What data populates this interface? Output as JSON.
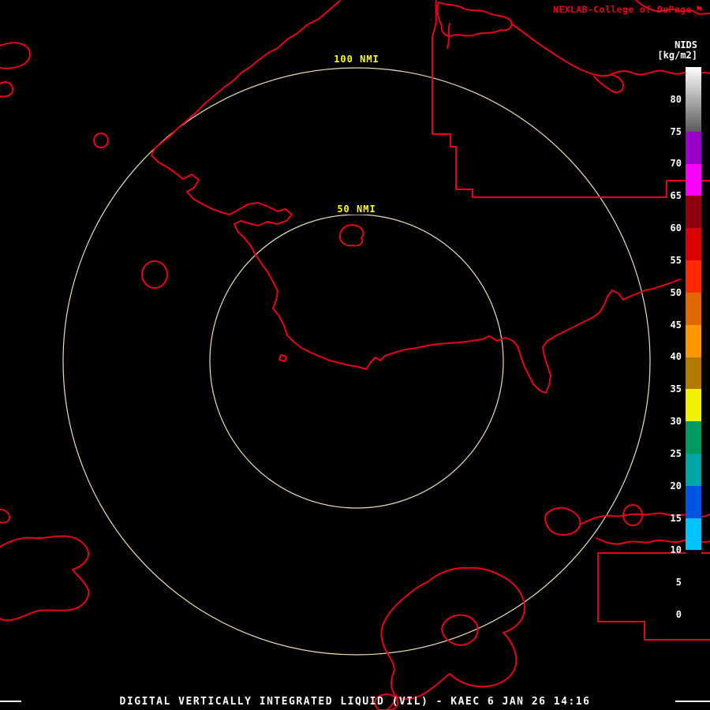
{
  "header": {
    "brand": "NEXLAB-College of DuPage",
    "brand_icon_char": "⚑",
    "product": "NIDS",
    "units": "[kg/m2]"
  },
  "map": {
    "background": "#000000",
    "outline_color": "#e60018",
    "ring_color": "#f0dcb4",
    "ring_label_color": "#ffff00",
    "rings": [
      {
        "label": "100 NMI",
        "radius_nmi": 100
      },
      {
        "label": "50 NMI",
        "radius_nmi": 50
      }
    ]
  },
  "colorbar": {
    "min": 0,
    "max": 85,
    "tick_color": "#ffffff",
    "ticks": [
      80,
      75,
      70,
      65,
      60,
      55,
      50,
      45,
      40,
      35,
      30,
      25,
      20,
      15,
      10,
      5,
      0
    ],
    "segments": [
      {
        "from": 0,
        "to": 5,
        "color": "#000000"
      },
      {
        "from": 5,
        "to": 10,
        "color": "#000000"
      },
      {
        "from": 10,
        "to": 15,
        "color": "#00c3ff"
      },
      {
        "from": 15,
        "to": 20,
        "color": "#0055e0"
      },
      {
        "from": 20,
        "to": 25,
        "color": "#00a4a4"
      },
      {
        "from": 25,
        "to": 30,
        "color": "#009a60"
      },
      {
        "from": 30,
        "to": 35,
        "color": "#f0f000"
      },
      {
        "from": 35,
        "to": 40,
        "color": "#b47a00"
      },
      {
        "from": 40,
        "to": 45,
        "color": "#ff9800"
      },
      {
        "from": 45,
        "to": 50,
        "color": "#e06800"
      },
      {
        "from": 50,
        "to": 55,
        "color": "#ff2800"
      },
      {
        "from": 55,
        "to": 60,
        "color": "#d80000"
      },
      {
        "from": 60,
        "to": 65,
        "color": "#8c0010"
      },
      {
        "from": 65,
        "to": 70,
        "color": "#ff00ff"
      },
      {
        "from": 70,
        "to": 75,
        "color": "#9600c8"
      },
      {
        "from": 75,
        "to": 85,
        "color": "#5a5a5a",
        "color_top": "#ffffff",
        "gradient": true
      }
    ]
  },
  "footer": {
    "caption": "DIGITAL VERTICALLY INTEGRATED LIQUID (VIL) - KAEC 6 JAN 26 14:16"
  }
}
